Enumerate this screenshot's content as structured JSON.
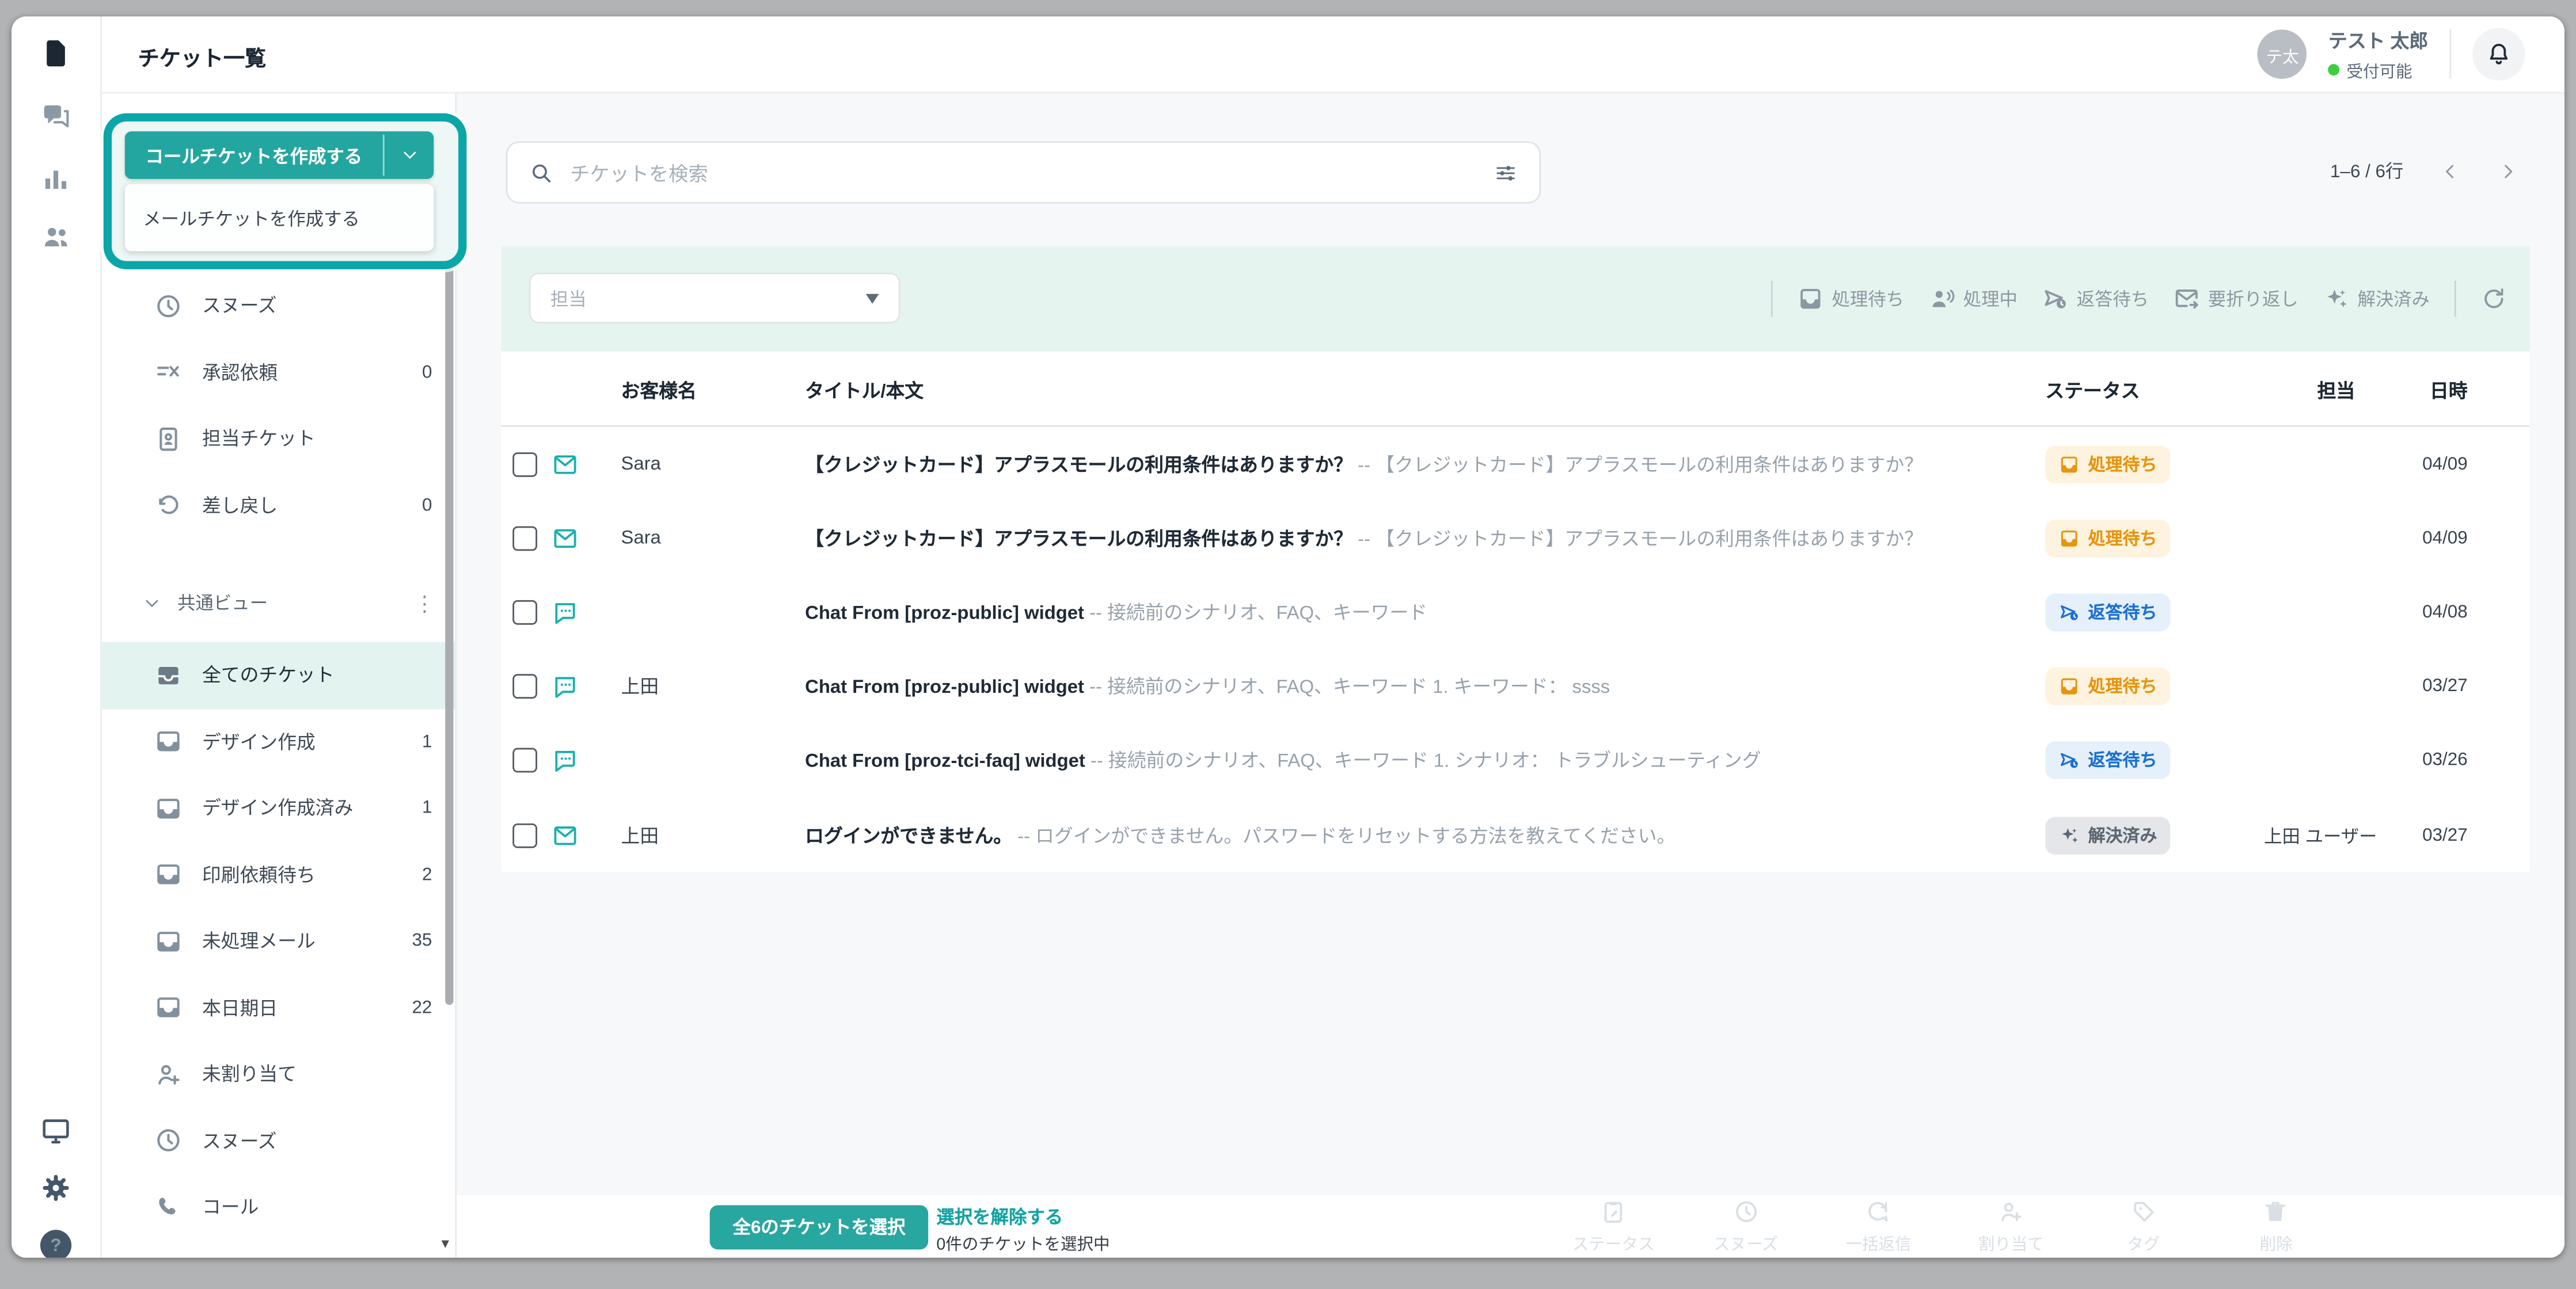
{
  "header": {
    "title": "チケット一覧",
    "user": {
      "initials": "テ太",
      "name": "テスト 太郎",
      "status_label": "受付可能"
    }
  },
  "create_split_button": {
    "primary_label": "コールチケットを作成する",
    "menu_items": [
      "メールチケットを作成する"
    ]
  },
  "sidebar": {
    "personal_items": [
      {
        "label": "スヌーズ",
        "count": "",
        "icon": "clock"
      },
      {
        "label": "承認依頼",
        "count": "0",
        "icon": "approval"
      },
      {
        "label": "担当チケット",
        "count": "",
        "icon": "id-card"
      },
      {
        "label": "差し戻し",
        "count": "0",
        "icon": "return"
      }
    ],
    "section": {
      "label": "共通ビュー"
    },
    "views": [
      {
        "label": "全てのチケット",
        "count": "",
        "icon": "inbox-solid",
        "selected": true
      },
      {
        "label": "デザイン作成",
        "count": "1",
        "icon": "inbox"
      },
      {
        "label": "デザイン作成済み",
        "count": "1",
        "icon": "inbox"
      },
      {
        "label": "印刷依頼待ち",
        "count": "2",
        "icon": "inbox"
      },
      {
        "label": "未処理メール",
        "count": "35",
        "icon": "inbox"
      },
      {
        "label": "本日期日",
        "count": "22",
        "icon": "inbox"
      },
      {
        "label": "未割り当て",
        "count": "",
        "icon": "person-plus"
      },
      {
        "label": "スヌーズ",
        "count": "",
        "icon": "clock"
      },
      {
        "label": "コール",
        "count": "",
        "icon": "phone"
      }
    ]
  },
  "search": {
    "placeholder": "チケットを検索"
  },
  "pagination": {
    "range_label": "1–6 / 6行"
  },
  "filter_bar": {
    "assignee_placeholder": "担当",
    "status_filters": [
      {
        "label": "処理待ち",
        "icon": "tray"
      },
      {
        "label": "処理中",
        "icon": "person-talking"
      },
      {
        "label": "返答待ち",
        "icon": "send-clock"
      },
      {
        "label": "要折り返し",
        "icon": "mail-arrow"
      },
      {
        "label": "解決済み",
        "icon": "sparkles"
      }
    ]
  },
  "table": {
    "columns": [
      "お客様名",
      "タイトル/本文",
      "ステータス",
      "担当",
      "日時"
    ],
    "rows": [
      {
        "channel": "mail",
        "customer": "Sara",
        "title": "【クレジットカード】アプラスモールの利用条件はありますか？",
        "preview": "-- 【クレジットカード】アプラスモールの利用条件はありますか？",
        "status": "処理待ち",
        "status_kind": "pending",
        "assignee": "",
        "date": "04/09"
      },
      {
        "channel": "mail",
        "customer": "Sara",
        "title": "【クレジットカード】アプラスモールの利用条件はありますか？",
        "preview": "-- 【クレジットカード】アプラスモールの利用条件はありますか？",
        "status": "処理待ち",
        "status_kind": "pending",
        "assignee": "",
        "date": "04/09"
      },
      {
        "channel": "chat",
        "customer": "",
        "title": "Chat From [proz-public] widget",
        "preview": "-- 接続前のシナリオ、FAQ、キーワード",
        "status": "返答待ち",
        "status_kind": "awaiting",
        "assignee": "",
        "date": "04/08"
      },
      {
        "channel": "chat",
        "customer": "上田",
        "title": "Chat From [proz-public] widget",
        "preview": "-- 接続前のシナリオ、FAQ、キーワード 1. キーワード： ssss",
        "status": "処理待ち",
        "status_kind": "pending",
        "assignee": "",
        "date": "03/27"
      },
      {
        "channel": "chat",
        "customer": "",
        "title": "Chat From [proz-tci-faq] widget",
        "preview": "-- 接続前のシナリオ、FAQ、キーワード 1. シナリオ： トラブルシューティング",
        "status": "返答待ち",
        "status_kind": "awaiting",
        "assignee": "",
        "date": "03/26"
      },
      {
        "channel": "mail",
        "customer": "上田",
        "title": "ログインができません。",
        "preview": "-- ログインができません。パスワードをリセットする方法を教えてください。",
        "status": "解決済み",
        "status_kind": "resolved",
        "assignee": "上田 ユーザー",
        "date": "03/27"
      }
    ]
  },
  "bottom_bar": {
    "select_all_label": "全6のチケットを選択",
    "clear_selection_label": "選択を解除する",
    "selection_info": "0件のチケットを選択中",
    "actions": [
      {
        "label": "ステータス",
        "icon": "clipboard-edit"
      },
      {
        "label": "スヌーズ",
        "icon": "clock"
      },
      {
        "label": "一括返信",
        "icon": "bubble-refresh"
      },
      {
        "label": "割り当て",
        "icon": "person-plus"
      },
      {
        "label": "タグ",
        "icon": "tag"
      },
      {
        "label": "削除",
        "icon": "trash"
      }
    ]
  },
  "colors": {
    "accent_teal": "#28a7a0",
    "annotation_ring": "#0aa6a8",
    "pending_fg": "#e8940c",
    "pending_bg": "#fdf3df",
    "awaiting_fg": "#1b6fd0",
    "awaiting_bg": "#e5f0fb",
    "resolved_fg": "#5c6773",
    "resolved_bg": "#e4e6e9",
    "selected_row_bg": "#e3f3f0",
    "status_online": "#3ecf3e"
  }
}
